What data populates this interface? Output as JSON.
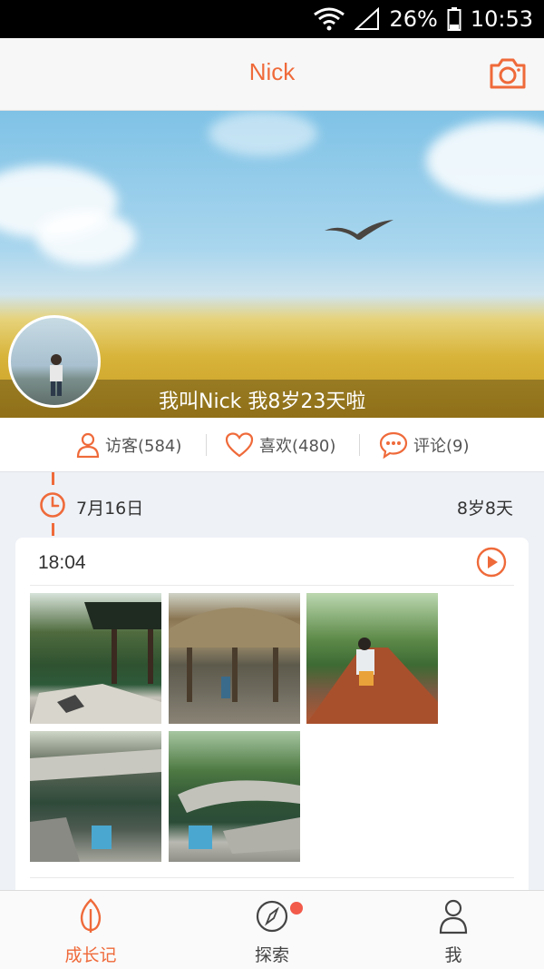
{
  "status_bar": {
    "battery": "26%",
    "time": "10:53",
    "icons": [
      "wifi-icon",
      "signal-icon",
      "battery-icon"
    ]
  },
  "header": {
    "title": "Nick",
    "camera_icon": "camera-icon"
  },
  "cover": {
    "caption": "我叫Nick 我8岁23天啦"
  },
  "stats": {
    "visitors": "访客(584)",
    "likes": "喜欢(480)",
    "comments": "评论(9)"
  },
  "timeline": {
    "date": "7月16日",
    "age": "8岁8天",
    "entry": {
      "time": "18:04",
      "photo_count": 5
    }
  },
  "bottom_nav": {
    "items": [
      {
        "label": "成长记",
        "icon": "leaf-icon",
        "active": true
      },
      {
        "label": "探索",
        "icon": "compass-icon",
        "active": false,
        "badge": true
      },
      {
        "label": "我",
        "icon": "person-icon",
        "active": false
      }
    ]
  },
  "colors": {
    "accent": "#ef6a3a",
    "badge": "#f25a4a",
    "background": "#eef1f6"
  }
}
